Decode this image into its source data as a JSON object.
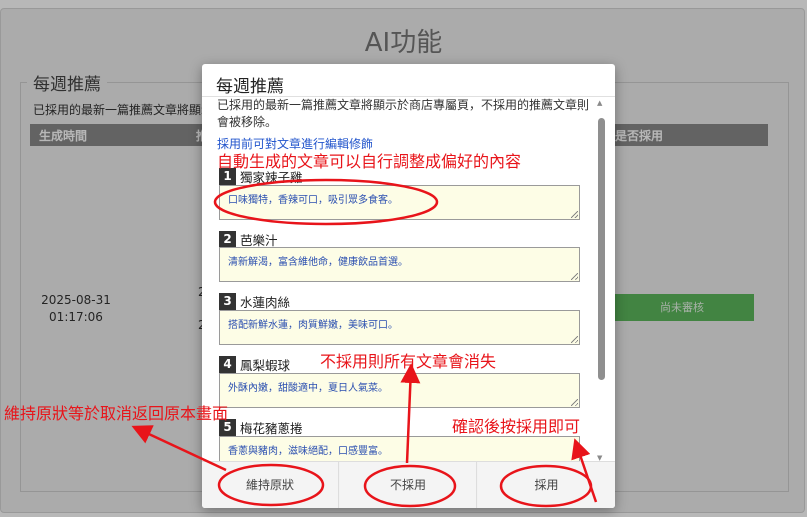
{
  "page": {
    "title": "AI功能",
    "legend": "每週推薦",
    "description": "已採用的最新一篇推薦文章將顯示於商店專屬頁，不採用的推薦",
    "columns": [
      "生成時間",
      "推",
      "是否採用"
    ],
    "row": {
      "date": "2025-08-31",
      "time": "01:17:06",
      "frag1": "2",
      "frag2": "2",
      "status": "尚未審核"
    }
  },
  "modal": {
    "title": "每週推薦",
    "desc": "已採用的最新一篇推薦文章將顯示於商店專屬頁，不採用的推薦文章則會被移除。",
    "link": "採用前可對文章進行編輯修飾",
    "items": [
      {
        "num": "1",
        "name": "獨家辣子雞",
        "text": "口味獨特，香辣可口，吸引眾多食客。"
      },
      {
        "num": "2",
        "name": "芭樂汁",
        "text": "清新解渴，富含維他命，健康飲品首選。"
      },
      {
        "num": "3",
        "name": "水蓮肉絲",
        "text": "搭配新鮮水蓮，肉質鮮嫩，美味可口。"
      },
      {
        "num": "4",
        "name": "鳳梨蝦球",
        "text": "外酥內嫩，甜酸適中，夏日人氣菜。"
      },
      {
        "num": "5",
        "name": "梅花豬蔥捲",
        "text": "香蔥與豬肉，滋味絕配，口感豐富。"
      }
    ],
    "buttons": {
      "keep": "維持原狀",
      "reject": "不採用",
      "adopt": "採用"
    }
  },
  "annotations": {
    "edit": "自動生成的文章可以自行調整成偏好的內容",
    "reject": "不採用則所有文章會消失",
    "keep": "維持原狀等於取消返回原本畫面",
    "adopt": "確認後按採用即可"
  },
  "colors": {
    "annotation": "#e8141a",
    "status": "#5cb85c",
    "link": "#2255cc",
    "textarea_bg": "#fdfde6"
  }
}
